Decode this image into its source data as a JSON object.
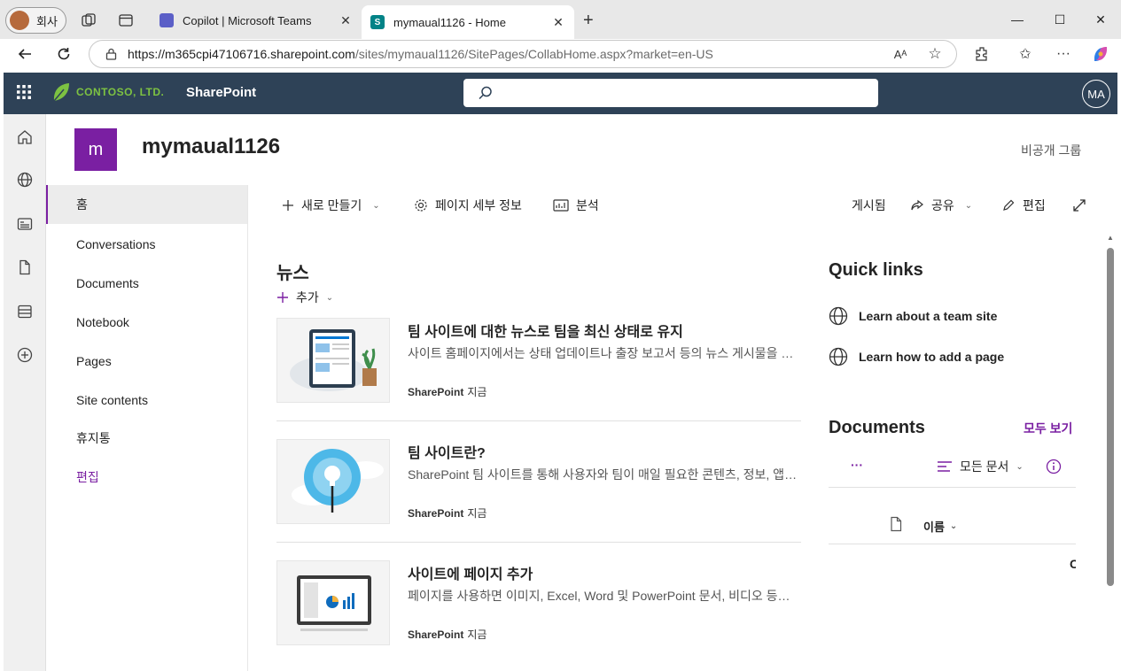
{
  "browser": {
    "profile_label": "회사",
    "tabs": [
      {
        "title": "Copilot | Microsoft Teams",
        "active": false
      },
      {
        "title": "mymaual1126 - Home",
        "active": true
      }
    ],
    "url_host": "https://m365cpi47106716.sharepoint.com",
    "url_path": "/sites/mymaual1126/SitePages/CollabHome.aspx?market=en-US"
  },
  "suite": {
    "brand": "CONTOSO, LTD.",
    "app": "SharePoint",
    "user_initials": "MA"
  },
  "site": {
    "logo_letter": "m",
    "title": "mymaual1126",
    "privacy": "비공개 그룹"
  },
  "nav": {
    "items": [
      {
        "label": "홈"
      },
      {
        "label": "Conversations"
      },
      {
        "label": "Documents"
      },
      {
        "label": "Notebook"
      },
      {
        "label": "Pages"
      },
      {
        "label": "Site contents"
      },
      {
        "label": "휴지통"
      },
      {
        "label": "편집"
      }
    ]
  },
  "commands": {
    "new": "새로 만들기",
    "page_details": "페이지 세부 정보",
    "analytics": "분석",
    "published": "게시됨",
    "share": "공유",
    "edit": "편집"
  },
  "news": {
    "heading": "뉴스",
    "add": "추가",
    "items": [
      {
        "title": "팀 사이트에 대한 뉴스로 팀을 최신 상태로 유지",
        "desc": "사이트 홈페이지에서는 상태 업데이트나 출장 보고서 등의 뉴스 게시물을 통해 팀 전체에 중요한 정보를 공유할 수 있습니다.",
        "author": "SharePoint",
        "time": "지금"
      },
      {
        "title": "팀 사이트란?",
        "desc": "SharePoint 팀 사이트를 통해 사용자와 팀이 매일 필요한 콘텐츠, 정보, 앱에 연결할 수 있습니다.",
        "author": "SharePoint",
        "time": "지금"
      },
      {
        "title": "사이트에 페이지 추가",
        "desc": "페이지를 사용하면 이미지, Excel, Word 및 PowerPoint 문서, 비디오 등을 공유할 수 있습니다.",
        "author": "SharePoint",
        "time": "지금"
      }
    ]
  },
  "quick_links": {
    "heading": "Quick links",
    "items": [
      {
        "label": "Learn about a team site"
      },
      {
        "label": "Learn how to add a page"
      }
    ]
  },
  "documents": {
    "heading": "Documents",
    "see_all": "모두 보기",
    "more": "···",
    "view": "모든 문서",
    "column_name": "이름",
    "truncated": "C"
  },
  "colors": {
    "suite_bar": "#2e4257",
    "accent": "#7a1fa2",
    "brand_green": "#7dc242"
  }
}
